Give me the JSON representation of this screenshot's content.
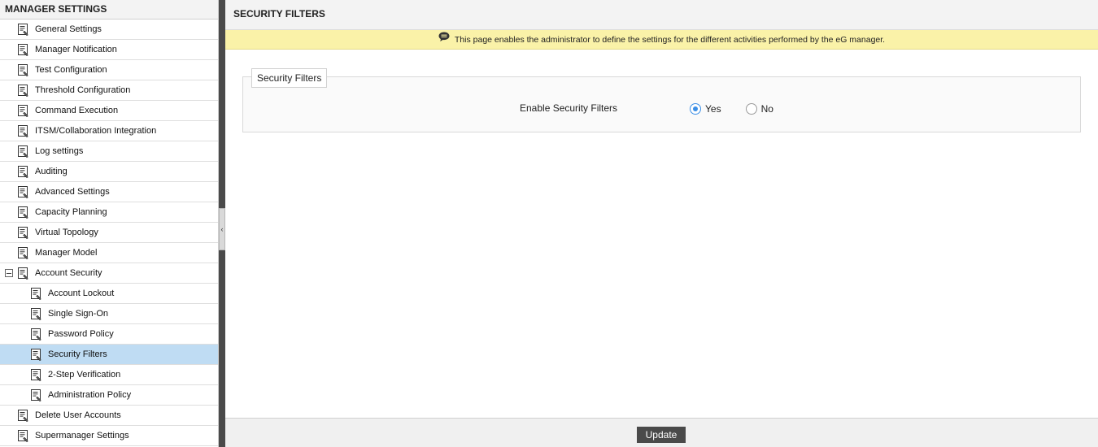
{
  "sidebar": {
    "title": "MANAGER SETTINGS",
    "items": [
      {
        "label": "General Settings",
        "level": 0
      },
      {
        "label": "Manager Notification",
        "level": 0
      },
      {
        "label": "Test Configuration",
        "level": 0
      },
      {
        "label": "Threshold Configuration",
        "level": 0
      },
      {
        "label": "Command Execution",
        "level": 0
      },
      {
        "label": "ITSM/Collaboration Integration",
        "level": 0
      },
      {
        "label": "Log settings",
        "level": 0
      },
      {
        "label": "Auditing",
        "level": 0
      },
      {
        "label": "Advanced Settings",
        "level": 0
      },
      {
        "label": "Capacity Planning",
        "level": 0
      },
      {
        "label": "Virtual Topology",
        "level": 0
      },
      {
        "label": "Manager Model",
        "level": 0
      },
      {
        "label": "Account Security",
        "level": 0,
        "expanded": true
      },
      {
        "label": "Account Lockout",
        "level": 1
      },
      {
        "label": "Single Sign-On",
        "level": 1
      },
      {
        "label": "Password Policy",
        "level": 1
      },
      {
        "label": "Security Filters",
        "level": 1,
        "selected": true
      },
      {
        "label": "2-Step Verification",
        "level": 1
      },
      {
        "label": "Administration Policy",
        "level": 1
      },
      {
        "label": "Delete User Accounts",
        "level": 0
      },
      {
        "label": "Supermanager Settings",
        "level": 0
      }
    ]
  },
  "main": {
    "title": "SECURITY FILTERS",
    "info_text": "This page enables the administrator to define the settings for the different activities performed by the eG manager.",
    "fieldset_legend": "Security Filters",
    "field_label": "Enable Security Filters",
    "radio_options": [
      {
        "label": "Yes",
        "checked": true
      },
      {
        "label": "No",
        "checked": false
      }
    ],
    "update_label": "Update"
  },
  "colors": {
    "selected_row": "#bfdcf3",
    "banner": "#faf2a8",
    "radio_accent": "#3a8ee6",
    "button": "#4a4a4a"
  }
}
